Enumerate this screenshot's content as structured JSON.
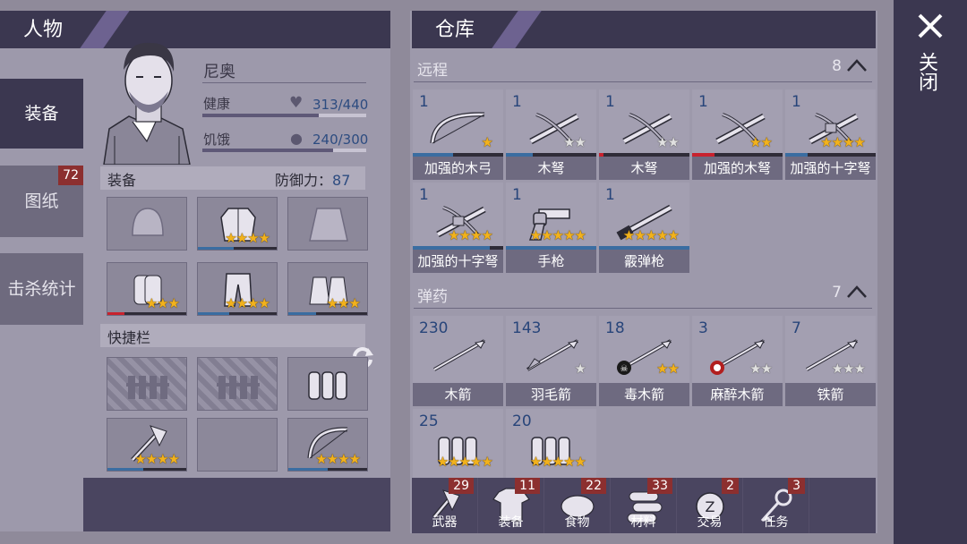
{
  "colors": {
    "accent_dark": "#3b3750",
    "badge_red": "#8c2f2f",
    "count_blue": "#28457a",
    "star_gold": "#f2b21c"
  },
  "character": {
    "panel_title": "人物",
    "name": "尼奥",
    "health_label": "健康",
    "health_value": "313/440",
    "health_fraction": 0.711,
    "hunger_label": "饥饿",
    "hunger_value": "240/300",
    "hunger_fraction": 0.8,
    "tabs": [
      {
        "label": "装备",
        "active": true,
        "badge": ""
      },
      {
        "label": "图纸",
        "active": false,
        "badge": "72"
      },
      {
        "label": "击杀统计",
        "active": false,
        "badge": ""
      }
    ],
    "equipment_label": "装备",
    "defense_label": "防御力：",
    "defense_value": "87",
    "quickbar_label": "快捷栏",
    "swap_icon": "swap-arrows-icon"
  },
  "equip_slots": [
    {
      "icon": "cap-icon",
      "stars": 0,
      "bar": 0,
      "bar_color": "#3a6da1"
    },
    {
      "icon": "armor-vest-icon",
      "stars": 4,
      "bar": 0.45,
      "bar_color": "#3a6da1"
    },
    {
      "icon": "jacket-icon",
      "stars": 0,
      "bar": 0,
      "bar_color": "#3a6da1"
    },
    {
      "icon": "gloves-icon",
      "stars": 3,
      "bar": 0.22,
      "bar_color": "#c8222e"
    },
    {
      "icon": "armor-pants-icon",
      "stars": 4,
      "bar": 0.4,
      "bar_color": "#3a6da1"
    },
    {
      "icon": "boots-icon",
      "stars": 3,
      "bar": 0.35,
      "bar_color": "#3a6da1"
    }
  ],
  "quick_slots": [
    {
      "icon": "locked-fence-icon",
      "locked": true,
      "stars": 0,
      "bar": 0
    },
    {
      "icon": "locked-fence-icon",
      "locked": true,
      "stars": 0,
      "bar": 0
    },
    {
      "icon": "ammo-icon",
      "locked": false,
      "stars": 0,
      "bar": 0
    },
    {
      "icon": "axe-icon",
      "locked": false,
      "stars": 4,
      "bar": 0.45
    },
    {
      "icon": "empty-slot",
      "locked": false,
      "stars": 0,
      "bar": 0
    },
    {
      "icon": "bow-icon",
      "locked": false,
      "stars": 4,
      "bar": 0.5
    }
  ],
  "storage": {
    "panel_title": "仓库",
    "close_label": "关闭",
    "ranged": {
      "title": "远程",
      "count": "8",
      "items": [
        {
          "count": "1",
          "label": "加强的木弓",
          "icon": "bow-icon",
          "stars_gold": 1,
          "stars_grey": 0,
          "bar": 0.45,
          "bar_color": "#3a6da1"
        },
        {
          "count": "1",
          "label": "木弩",
          "icon": "crossbow-icon",
          "stars_gold": 0,
          "stars_grey": 2,
          "bar": 0.3,
          "bar_color": "#3a6da1"
        },
        {
          "count": "1",
          "label": "木弩",
          "icon": "crossbow-icon",
          "stars_gold": 0,
          "stars_grey": 2,
          "bar": 0.05,
          "bar_color": "#c8222e"
        },
        {
          "count": "1",
          "label": "加强的木弩",
          "icon": "crossbow-icon",
          "stars_gold": 2,
          "stars_grey": 0,
          "bar": 0.25,
          "bar_color": "#c8222e"
        },
        {
          "count": "1",
          "label": "加强的十字弩",
          "icon": "heavy-crossbow-icon",
          "stars_gold": 4,
          "stars_grey": 0,
          "bar": 0.25,
          "bar_color": "#3a6da1"
        },
        {
          "count": "1",
          "label": "加强的十字弩",
          "icon": "heavy-crossbow-icon",
          "stars_gold": 4,
          "stars_grey": 0,
          "bar": 0.85,
          "bar_color": "#3a6da1"
        },
        {
          "count": "1",
          "label": "手枪",
          "icon": "revolver-icon",
          "stars_gold": 5,
          "stars_grey": 0,
          "bar": 1.0,
          "bar_color": "#3a6da1"
        },
        {
          "count": "1",
          "label": "霰弹枪",
          "icon": "shotgun-icon",
          "stars_gold": 5,
          "stars_grey": 0,
          "bar": 1.0,
          "bar_color": "#3a6da1"
        }
      ]
    },
    "ammo": {
      "title": "弹药",
      "count": "7",
      "items": [
        {
          "count": "230",
          "label": "木箭",
          "icon": "arrow-icon",
          "stars_gold": 0,
          "stars_grey": 0
        },
        {
          "count": "143",
          "label": "羽毛箭",
          "icon": "feather-arrow-icon",
          "stars_gold": 0,
          "stars_grey": 1
        },
        {
          "count": "18",
          "label": "毒木箭",
          "icon": "poison-arrow-icon",
          "stars_gold": 2,
          "stars_grey": 0
        },
        {
          "count": "3",
          "label": "麻醉木箭",
          "icon": "tranq-arrow-icon",
          "stars_gold": 0,
          "stars_grey": 2
        },
        {
          "count": "7",
          "label": "铁箭",
          "icon": "iron-arrow-icon",
          "stars_gold": 0,
          "stars_grey": 3
        },
        {
          "count": "25",
          "label": "",
          "icon": "bullets-icon",
          "stars_gold": 5,
          "stars_grey": 0
        },
        {
          "count": "20",
          "label": "",
          "icon": "shells-icon",
          "stars_gold": 5,
          "stars_grey": 0
        }
      ]
    },
    "bottom_tabs": [
      {
        "label": "武器",
        "badge": "29",
        "icon": "axe-icon"
      },
      {
        "label": "装备",
        "badge": "11",
        "icon": "shirt-icon"
      },
      {
        "label": "食物",
        "badge": "22",
        "icon": "meat-icon"
      },
      {
        "label": "材料",
        "badge": "33",
        "icon": "logs-icon"
      },
      {
        "label": "交易",
        "badge": "2",
        "icon": "coin-icon"
      },
      {
        "label": "任务",
        "badge": "3",
        "icon": "key-icon"
      }
    ]
  }
}
